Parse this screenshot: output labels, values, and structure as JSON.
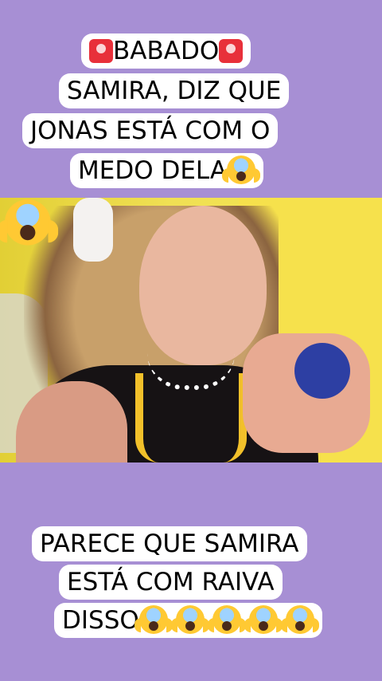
{
  "top_caption": {
    "line1": "BABADO",
    "line2": "SAMIRA, DIZ QUE",
    "line3": "JONAS ESTÁ COM O",
    "line4": "MEDO DELA"
  },
  "bottom_caption": {
    "line1": "PARECE QUE SAMIRA",
    "line2": "ESTÁ COM RAIVA",
    "line3": "DISSO"
  },
  "colors": {
    "background": "#a78fd4",
    "caption_bg": "#ffffff",
    "siren": "#e8303a"
  },
  "icons": [
    "siren-icon",
    "face-screaming-icon"
  ]
}
